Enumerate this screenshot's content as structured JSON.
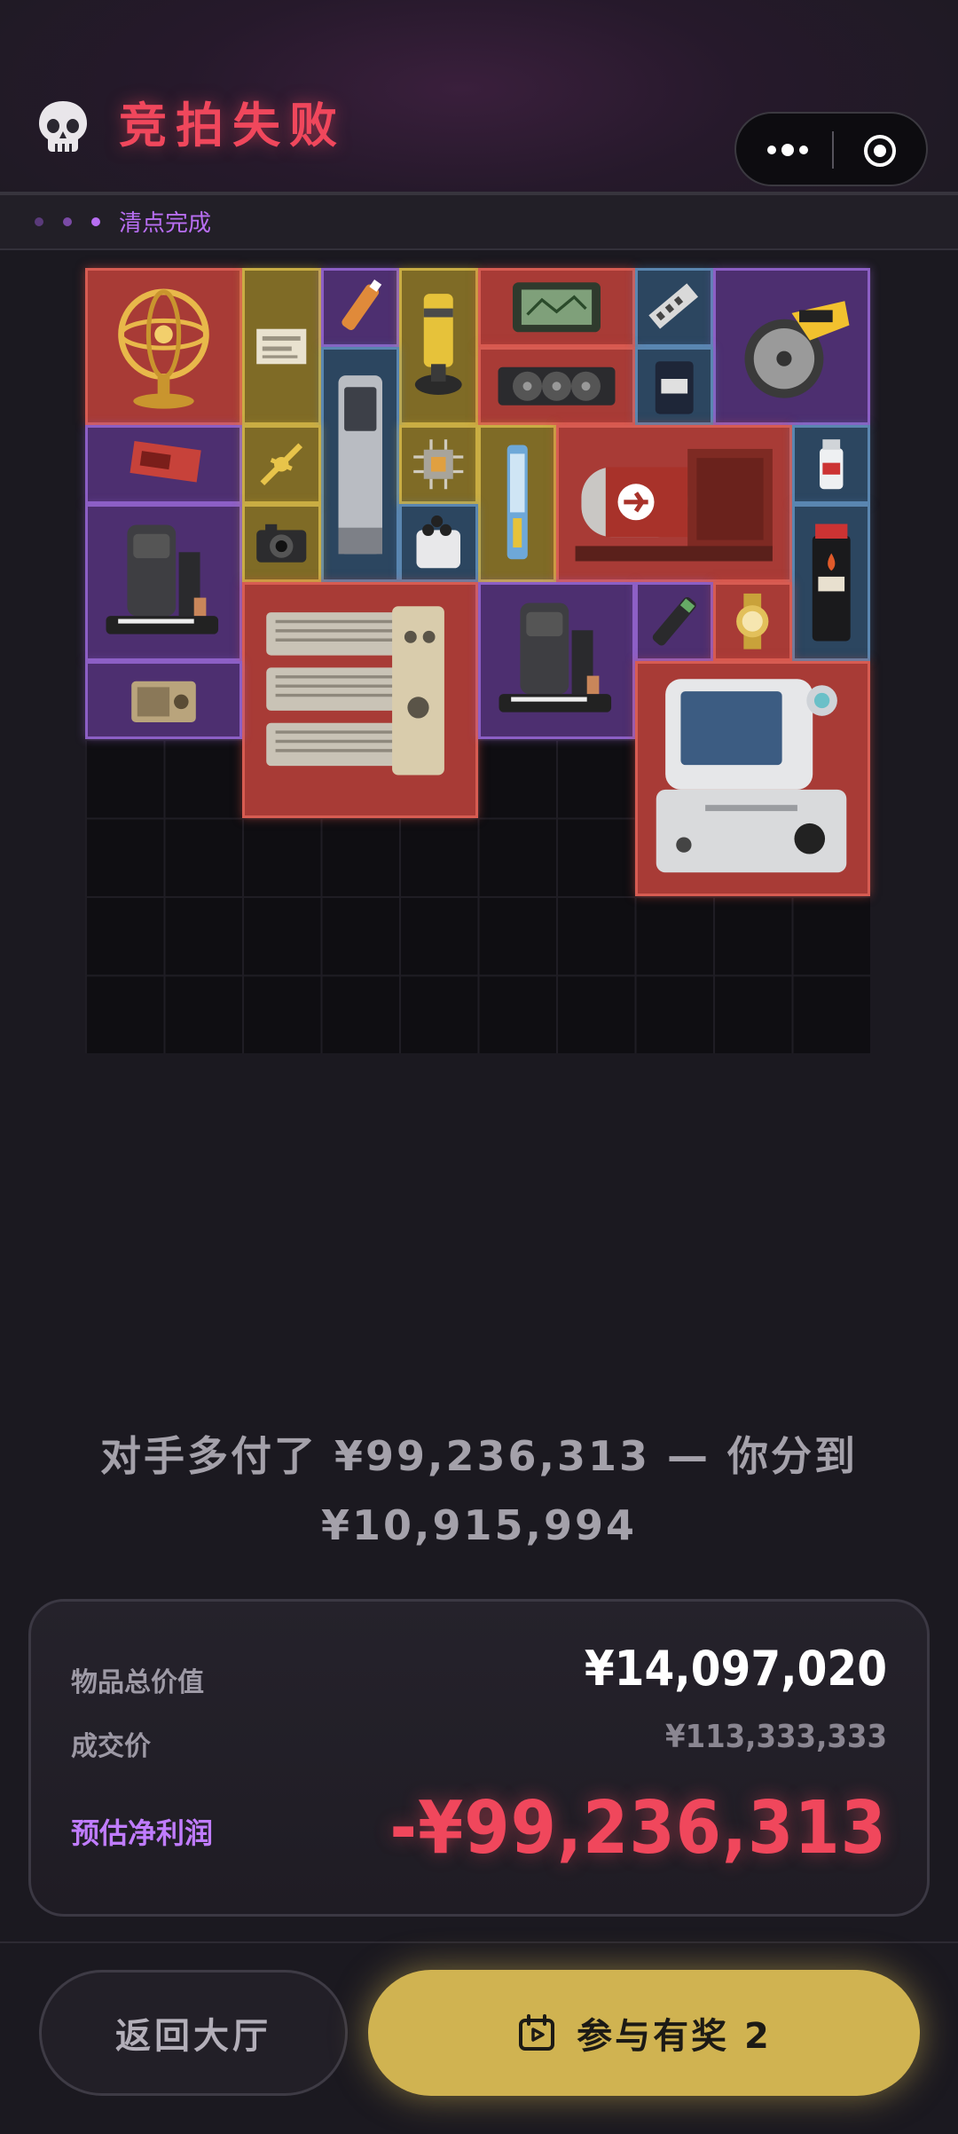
{
  "header": {
    "title": "竞拍失败",
    "skull_icon": "skull-icon",
    "more_icon": "more-dots-icon",
    "target_icon": "target-icon"
  },
  "status": {
    "text": "清点完成"
  },
  "grid": {
    "items": [
      {
        "name": "armillary-sphere",
        "rarity": "red"
      },
      {
        "name": "document",
        "rarity": "gold"
      },
      {
        "name": "syringe",
        "rarity": "purple"
      },
      {
        "name": "lantern",
        "rarity": "gold"
      },
      {
        "name": "tablet",
        "rarity": "red"
      },
      {
        "name": "ram-stick",
        "rarity": "blue"
      },
      {
        "name": "circular-saw",
        "rarity": "purple"
      },
      {
        "name": "graphics-card",
        "rarity": "red"
      },
      {
        "name": "coffee-bag",
        "rarity": "blue"
      },
      {
        "name": "power-bank",
        "rarity": "blue"
      },
      {
        "name": "red-gpu",
        "rarity": "purple"
      },
      {
        "name": "compass-key",
        "rarity": "gold"
      },
      {
        "name": "circuit-chip",
        "rarity": "gold"
      },
      {
        "name": "blue-tool",
        "rarity": "gold"
      },
      {
        "name": "aircraft-engine",
        "rarity": "red"
      },
      {
        "name": "medicine-bottle",
        "rarity": "blue"
      },
      {
        "name": "coffee-machine",
        "rarity": "purple"
      },
      {
        "name": "camera",
        "rarity": "gold"
      },
      {
        "name": "capacitor-jar",
        "rarity": "blue"
      },
      {
        "name": "black-powder",
        "rarity": "blue"
      },
      {
        "name": "server-module",
        "rarity": "red"
      },
      {
        "name": "coffee-machine",
        "rarity": "purple"
      },
      {
        "name": "flashlight",
        "rarity": "purple"
      },
      {
        "name": "gold-watch",
        "rarity": "red"
      },
      {
        "name": "radio",
        "rarity": "purple"
      },
      {
        "name": "medical-monitor",
        "rarity": "red"
      }
    ]
  },
  "summary": {
    "line1": "对手多付了 ¥99,236,313 — 你分到",
    "line2": "¥10,915,994"
  },
  "card": {
    "total_label": "物品总价值",
    "total_value": "¥14,097,020",
    "deal_label": "成交价",
    "deal_value": "¥113,333,333",
    "profit_label": "预估净利润",
    "profit_value": "-¥99,236,313"
  },
  "footer": {
    "back_label": "返回大厅",
    "join_label": "参与有奖 2",
    "join_icon": "gift-ticket-icon"
  },
  "colors": {
    "red": "#f0475c",
    "purple": "#c07cff",
    "gold": "#d0b351"
  }
}
